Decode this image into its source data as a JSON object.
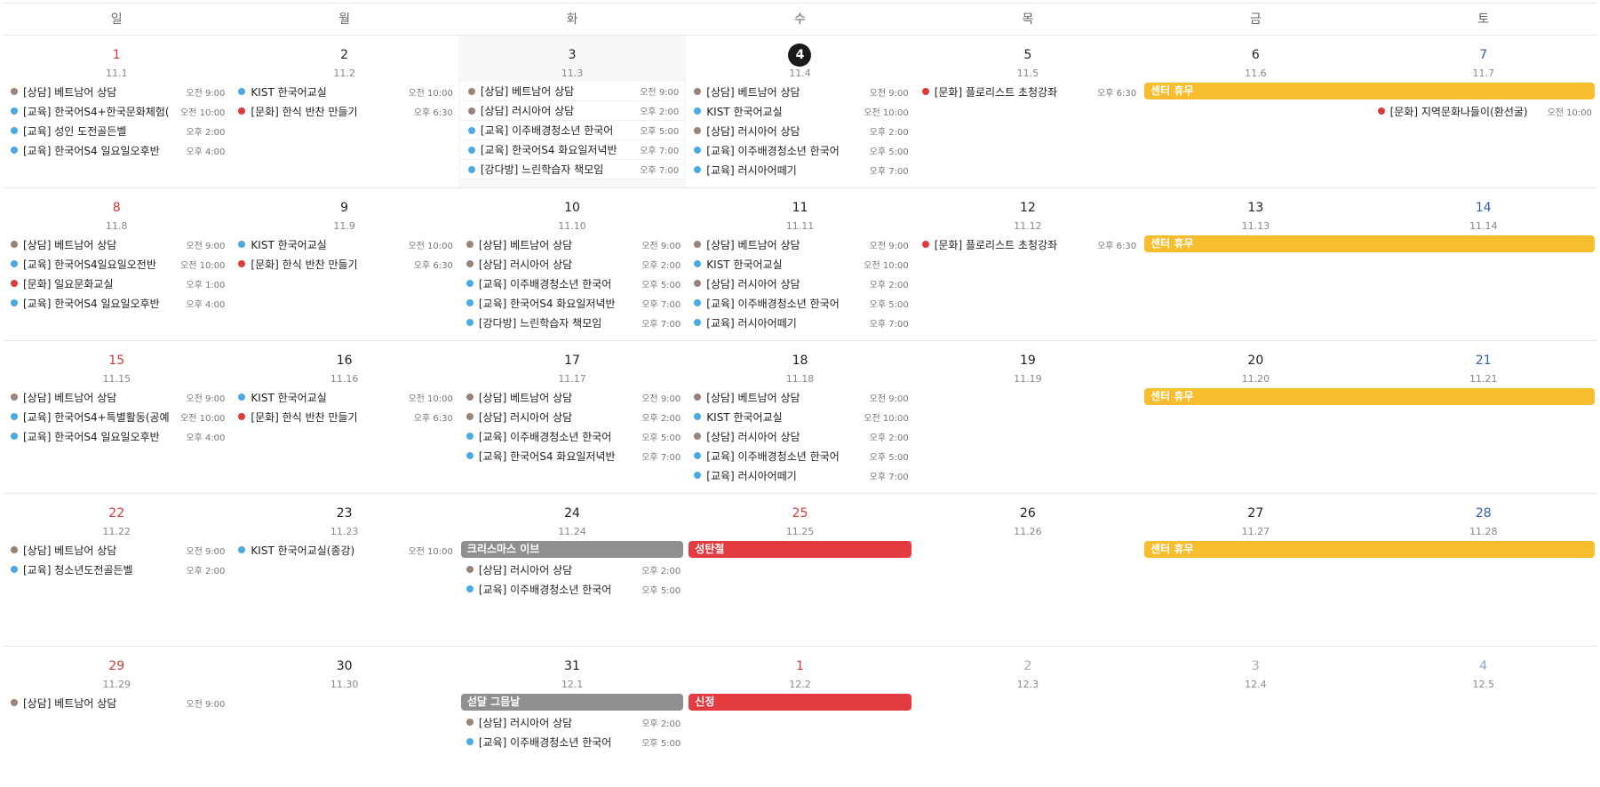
{
  "weekdays": [
    "일",
    "월",
    "화",
    "수",
    "목",
    "금",
    "토"
  ],
  "colors": {
    "consult": "#9a8376",
    "edu": "#4ba9e3",
    "culture": "#dd3a3a",
    "holiday_red": "#e33b3f",
    "gray_bar": "#8f8f8f",
    "closed_yellow": "#f7bd2e"
  },
  "weeks": [
    {
      "days": [
        {
          "num": "1",
          "lunar": "11.1",
          "kind": "sun",
          "events": [
            {
              "cat": "consult",
              "title": "[상담] 베트남어 상담",
              "time": "오전 9:00"
            },
            {
              "cat": "edu",
              "title": "[교육] 한국어S4+한국문화체험(",
              "time": "오전 10:00"
            },
            {
              "cat": "edu",
              "title": "[교육] 성인 도전골든벨",
              "time": "오후 2:00"
            },
            {
              "cat": "edu",
              "title": "[교육] 한국어S4 일요일오후반",
              "time": "오후 4:00"
            }
          ]
        },
        {
          "num": "2",
          "lunar": "11.2",
          "kind": "",
          "events": [
            {
              "cat": "edu",
              "title": "KIST 한국어교실",
              "time": "오전 10:00"
            },
            {
              "cat": "culture",
              "title": "[문화] 한식 반찬 만들기",
              "time": "오후 6:30"
            }
          ]
        },
        {
          "num": "3",
          "lunar": "11.3",
          "kind": "",
          "shade": true,
          "events": [
            {
              "cat": "consult",
              "title": "[상담] 베트남어 상담",
              "time": "오전 9:00"
            },
            {
              "cat": "consult",
              "title": "[상담] 러시아어 상담",
              "time": "오후 2:00"
            },
            {
              "cat": "edu",
              "title": "[교육] 이주배경청소년 한국어",
              "time": "오후 5:00"
            },
            {
              "cat": "edu",
              "title": "[교육] 한국어S4 화요일저녁반",
              "time": "오후 7:00"
            },
            {
              "cat": "edu",
              "title": "[강다방] 느린학습자 책모임",
              "time": "오후 7:00"
            }
          ]
        },
        {
          "num": "4",
          "lunar": "11.4",
          "kind": "today",
          "events": [
            {
              "cat": "consult",
              "title": "[상담] 베트남어 상담",
              "time": "오전 9:00"
            },
            {
              "cat": "edu",
              "title": "KIST 한국어교실",
              "time": "오전 10:00"
            },
            {
              "cat": "consult",
              "title": "[상담] 러시아어 상담",
              "time": "오후 2:00"
            },
            {
              "cat": "edu",
              "title": "[교육] 이주배경청소년 한국어",
              "time": "오후 5:00"
            },
            {
              "cat": "edu",
              "title": "[교육] 러시아어떼기",
              "time": "오후 7:00"
            }
          ]
        },
        {
          "num": "5",
          "lunar": "11.5",
          "kind": "",
          "events": [
            {
              "cat": "culture",
              "title": "[문화] 플로리스트 초청강좌",
              "time": "오후 6:30"
            }
          ]
        },
        {
          "num": "6",
          "lunar": "11.6",
          "kind": "",
          "events": []
        },
        {
          "num": "7",
          "lunar": "11.7",
          "kind": "sat",
          "skip": 1,
          "events": [
            {
              "cat": "culture",
              "title": "[문화] 지역문화나들이(환선굴)",
              "time": "오전 10:00"
            }
          ]
        }
      ],
      "bars": [
        {
          "label": "센터 휴무",
          "color": "closed_yellow",
          "start": 5,
          "span": 2
        }
      ]
    },
    {
      "days": [
        {
          "num": "8",
          "lunar": "11.8",
          "kind": "sun",
          "events": [
            {
              "cat": "consult",
              "title": "[상담] 베트남어 상담",
              "time": "오전 9:00"
            },
            {
              "cat": "edu",
              "title": "[교육] 한국어S4일요일오전반",
              "time": "오전 10:00"
            },
            {
              "cat": "culture",
              "title": "[문화] 일요문화교실",
              "time": "오후 1:00"
            },
            {
              "cat": "edu",
              "title": "[교육] 한국어S4 일요일오후반",
              "time": "오후 4:00"
            }
          ]
        },
        {
          "num": "9",
          "lunar": "11.9",
          "kind": "",
          "events": [
            {
              "cat": "edu",
              "title": "KIST 한국어교실",
              "time": "오전 10:00"
            },
            {
              "cat": "culture",
              "title": "[문화] 한식 반찬 만들기",
              "time": "오후 6:30"
            }
          ]
        },
        {
          "num": "10",
          "lunar": "11.10",
          "kind": "",
          "events": [
            {
              "cat": "consult",
              "title": "[상담] 베트남어 상담",
              "time": "오전 9:00"
            },
            {
              "cat": "consult",
              "title": "[상담] 러시아어 상담",
              "time": "오후 2:00"
            },
            {
              "cat": "edu",
              "title": "[교육] 이주배경청소년 한국어",
              "time": "오후 5:00"
            },
            {
              "cat": "edu",
              "title": "[교육] 한국어S4 화요일저녁반",
              "time": "오후 7:00"
            },
            {
              "cat": "edu",
              "title": "[강다방] 느린학습자 책모임",
              "time": "오후 7:00"
            }
          ]
        },
        {
          "num": "11",
          "lunar": "11.11",
          "kind": "",
          "events": [
            {
              "cat": "consult",
              "title": "[상담] 베트남어 상담",
              "time": "오전 9:00"
            },
            {
              "cat": "edu",
              "title": "KIST 한국어교실",
              "time": "오전 10:00"
            },
            {
              "cat": "consult",
              "title": "[상담] 러시아어 상담",
              "time": "오후 2:00"
            },
            {
              "cat": "edu",
              "title": "[교육] 이주배경청소년 한국어",
              "time": "오후 5:00"
            },
            {
              "cat": "edu",
              "title": "[교육] 러시아어떼기",
              "time": "오후 7:00"
            }
          ]
        },
        {
          "num": "12",
          "lunar": "11.12",
          "kind": "",
          "events": [
            {
              "cat": "culture",
              "title": "[문화] 플로리스트 초청강좌",
              "time": "오후 6:30"
            }
          ]
        },
        {
          "num": "13",
          "lunar": "11.13",
          "kind": "",
          "events": []
        },
        {
          "num": "14",
          "lunar": "11.14",
          "kind": "sat",
          "events": []
        }
      ],
      "bars": [
        {
          "label": "센터 휴무",
          "color": "closed_yellow",
          "start": 5,
          "span": 2
        }
      ]
    },
    {
      "days": [
        {
          "num": "15",
          "lunar": "11.15",
          "kind": "sun",
          "events": [
            {
              "cat": "consult",
              "title": "[상담] 베트남어 상담",
              "time": "오전 9:00"
            },
            {
              "cat": "edu",
              "title": "[교육] 한국어S4+특별활동(공예",
              "time": "오전 10:00"
            },
            {
              "cat": "edu",
              "title": "[교육] 한국어S4 일요일오후반",
              "time": "오후 4:00"
            }
          ]
        },
        {
          "num": "16",
          "lunar": "11.16",
          "kind": "",
          "events": [
            {
              "cat": "edu",
              "title": "KIST 한국어교실",
              "time": "오전 10:00"
            },
            {
              "cat": "culture",
              "title": "[문화] 한식 반찬 만들기",
              "time": "오후 6:30"
            }
          ]
        },
        {
          "num": "17",
          "lunar": "11.17",
          "kind": "",
          "events": [
            {
              "cat": "consult",
              "title": "[상담] 베트남어 상담",
              "time": "오전 9:00"
            },
            {
              "cat": "consult",
              "title": "[상담] 러시아어 상담",
              "time": "오후 2:00"
            },
            {
              "cat": "edu",
              "title": "[교육] 이주배경청소년 한국어",
              "time": "오후 5:00"
            },
            {
              "cat": "edu",
              "title": "[교육] 한국어S4 화요일저녁반",
              "time": "오후 7:00"
            }
          ]
        },
        {
          "num": "18",
          "lunar": "11.18",
          "kind": "",
          "events": [
            {
              "cat": "consult",
              "title": "[상담] 베트남어 상담",
              "time": "오전 9:00"
            },
            {
              "cat": "edu",
              "title": "KIST 한국어교실",
              "time": "오전 10:00"
            },
            {
              "cat": "consult",
              "title": "[상담] 러시아어 상담",
              "time": "오후 2:00"
            },
            {
              "cat": "edu",
              "title": "[교육] 이주배경청소년 한국어",
              "time": "오후 5:00"
            },
            {
              "cat": "edu",
              "title": "[교육] 러시아어떼기",
              "time": "오후 7:00"
            }
          ]
        },
        {
          "num": "19",
          "lunar": "11.19",
          "kind": "",
          "events": []
        },
        {
          "num": "20",
          "lunar": "11.20",
          "kind": "",
          "events": []
        },
        {
          "num": "21",
          "lunar": "11.21",
          "kind": "sat",
          "events": []
        }
      ],
      "bars": [
        {
          "label": "센터 휴무",
          "color": "closed_yellow",
          "start": 5,
          "span": 2
        }
      ]
    },
    {
      "days": [
        {
          "num": "22",
          "lunar": "11.22",
          "kind": "sun",
          "events": [
            {
              "cat": "consult",
              "title": "[상담] 베트남어 상담",
              "time": "오전 9:00"
            },
            {
              "cat": "edu",
              "title": "[교육] 청소년도전골든벨",
              "time": "오후 2:00"
            }
          ]
        },
        {
          "num": "23",
          "lunar": "11.23",
          "kind": "",
          "events": [
            {
              "cat": "edu",
              "title": "KIST 한국어교실(종강)",
              "time": "오전 10:00"
            }
          ]
        },
        {
          "num": "24",
          "lunar": "11.24",
          "kind": "",
          "skip": 1,
          "events": [
            {
              "cat": "consult",
              "title": "[상담] 러시아어 상담",
              "time": "오후 2:00"
            },
            {
              "cat": "edu",
              "title": "[교육] 이주배경청소년 한국어",
              "time": "오후 5:00"
            }
          ]
        },
        {
          "num": "25",
          "lunar": "11.25",
          "kind": "sun",
          "events": []
        },
        {
          "num": "26",
          "lunar": "11.26",
          "kind": "",
          "events": []
        },
        {
          "num": "27",
          "lunar": "11.27",
          "kind": "",
          "events": []
        },
        {
          "num": "28",
          "lunar": "11.28",
          "kind": "sat",
          "events": []
        }
      ],
      "bars": [
        {
          "label": "크리스마스 이브",
          "color": "gray_bar",
          "start": 2,
          "span": 1
        },
        {
          "label": "성탄절",
          "color": "holiday_red",
          "start": 3,
          "span": 1
        },
        {
          "label": "센터 휴무",
          "color": "closed_yellow",
          "start": 5,
          "span": 2
        }
      ]
    },
    {
      "days": [
        {
          "num": "29",
          "lunar": "11.29",
          "kind": "sun",
          "events": [
            {
              "cat": "consult",
              "title": "[상담] 베트남어 상담",
              "time": "오전 9:00"
            }
          ]
        },
        {
          "num": "30",
          "lunar": "11.30",
          "kind": "",
          "events": []
        },
        {
          "num": "31",
          "lunar": "12.1",
          "kind": "",
          "skip": 1,
          "events": [
            {
              "cat": "consult",
              "title": "[상담] 러시아어 상담",
              "time": "오후 2:00"
            },
            {
              "cat": "edu",
              "title": "[교육] 이주배경청소년 한국어",
              "time": "오후 5:00"
            }
          ]
        },
        {
          "num": "1",
          "lunar": "12.2",
          "kind": "sun",
          "events": []
        },
        {
          "num": "2",
          "lunar": "12.3",
          "kind": "other",
          "events": []
        },
        {
          "num": "3",
          "lunar": "12.4",
          "kind": "other",
          "events": []
        },
        {
          "num": "4",
          "lunar": "12.5",
          "kind": "other sat",
          "events": []
        }
      ],
      "bars": [
        {
          "label": "섣달 그믐날",
          "color": "gray_bar",
          "start": 2,
          "span": 1
        },
        {
          "label": "신정",
          "color": "holiday_red",
          "start": 3,
          "span": 1
        }
      ]
    }
  ]
}
